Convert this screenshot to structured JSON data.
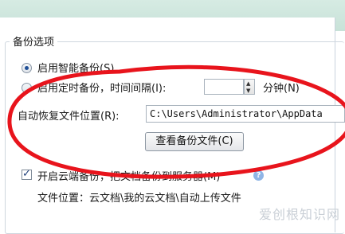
{
  "group": {
    "title": "备份选项"
  },
  "options": {
    "smart_backup_label": "启用智能备份(S)",
    "timed_backup_label": "启用定时备份，时间间隔(I):",
    "interval_unit": "分钟(N)",
    "interval_value": ""
  },
  "restore": {
    "label": "自动恢复文件位置(R):",
    "path": "C:\\Users\\Administrator\\AppData"
  },
  "buttons": {
    "view_backup": "查看备份文件(C)"
  },
  "cloud": {
    "checkbox_label": "开启云端备份，把文档备份到服务器(M)",
    "help_glyph": "?",
    "location_text": "文件位置：云文档\\我的云文档\\自动上传文件"
  },
  "watermark": "爱创根知识网",
  "colors": {
    "annotation": "#e8141c",
    "top_band": "#d6ebe3"
  }
}
